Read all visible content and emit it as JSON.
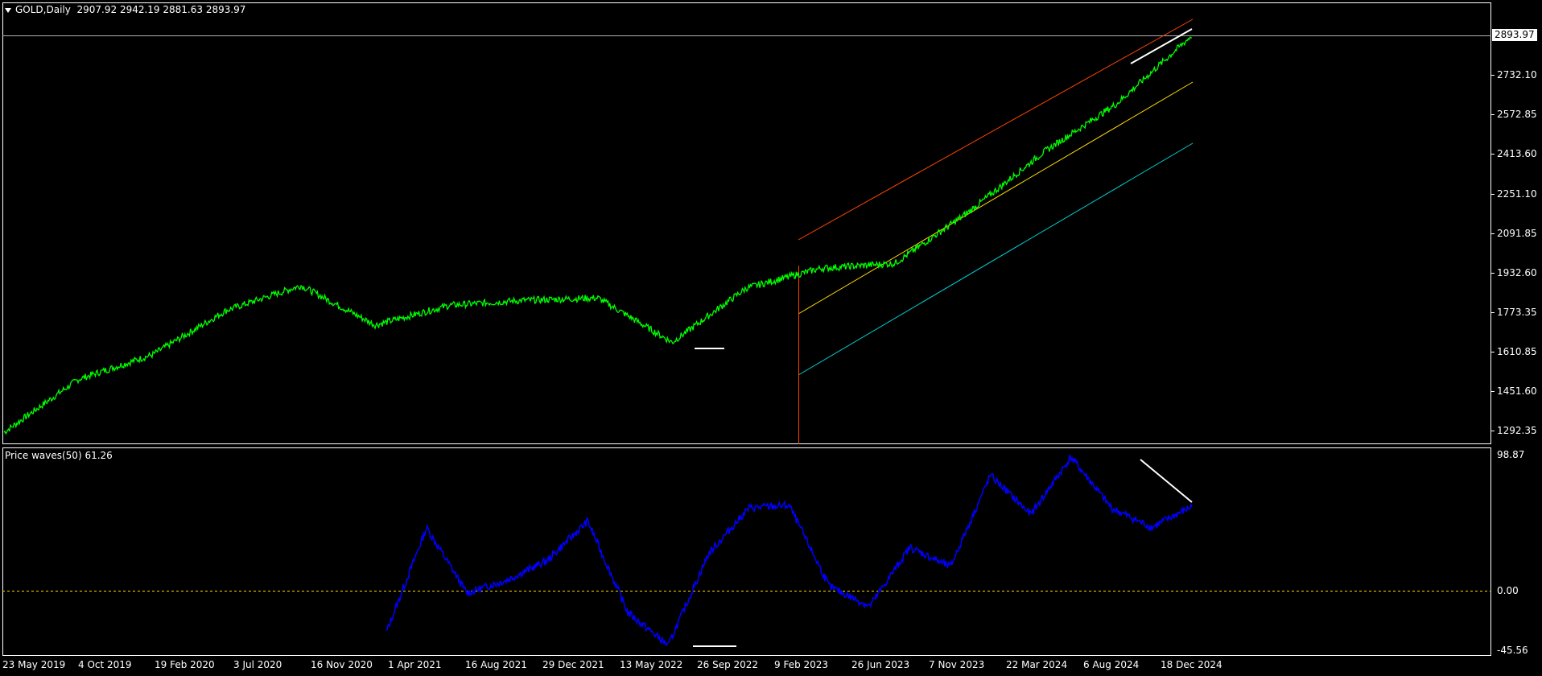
{
  "header": {
    "symbol": "GOLD,Daily",
    "ohlc": "2907.92 2942.19 2881.63 2893.97"
  },
  "indicator": {
    "title": "Price waves(50) 61.26"
  },
  "price_axis": {
    "current_price": "2893.97",
    "ticks": [
      "2732.10",
      "2572.85",
      "2413.60",
      "2251.10",
      "2091.85",
      "1932.60",
      "1773.35",
      "1610.85",
      "1451.60",
      "1292.35"
    ]
  },
  "indicator_axis": {
    "ticks": [
      "98.87",
      "0.00",
      "-45.56"
    ]
  },
  "time_axis": {
    "labels": [
      "23 May 2019",
      "4 Oct 2019",
      "19 Feb 2020",
      "3 Jul 2020",
      "16 Nov 2020",
      "1 Apr 2021",
      "16 Aug 2021",
      "29 Dec 2021",
      "13 May 2022",
      "26 Sep 2022",
      "9 Feb 2023",
      "26 Jun 2023",
      "7 Nov 2023",
      "22 Mar 2024",
      "6 Aug 2024",
      "18 Dec 2024"
    ]
  },
  "colors": {
    "background": "#000000",
    "price_line": "#00ff00",
    "indicator_line": "#0000ff",
    "channel_upper": "#ff4500",
    "channel_mid": "#ffd700",
    "channel_lower": "#00ced1",
    "zero_line": "#ffd700",
    "trend_marks": "#ffffff",
    "vertical_marker": "#ff4500"
  },
  "chart_data": [
    {
      "type": "line",
      "name": "GOLD,Daily",
      "ylim": [
        1292.35,
        2893.97
      ],
      "x": [
        "23 May 2019",
        "4 Oct 2019",
        "19 Feb 2020",
        "3 Jul 2020",
        "16 Nov 2020",
        "1 Apr 2021",
        "16 Aug 2021",
        "29 Dec 2021",
        "13 May 2022",
        "26 Sep 2022",
        "9 Feb 2023",
        "26 Jun 2023",
        "7 Nov 2023",
        "22 Mar 2024",
        "6 Aug 2024",
        "18 Dec 2024"
      ],
      "series": [
        {
          "values": [
            1285,
            1500,
            1600,
            1780,
            1880,
            1720,
            1800,
            1820,
            1830,
            1650,
            1870,
            1950,
            1970,
            2180,
            2420,
            2620,
            2893.97
          ]
        }
      ]
    },
    {
      "type": "line",
      "name": "Price waves(50)",
      "ylim": [
        -45.56,
        98.87
      ],
      "series": [
        {
          "values": [
            -35,
            45,
            -5,
            5,
            20,
            50,
            -20,
            -45,
            25,
            60,
            62,
            0,
            -15,
            30,
            15,
            85,
            55,
            98.87,
            60,
            45,
            61.26
          ]
        }
      ]
    }
  ]
}
